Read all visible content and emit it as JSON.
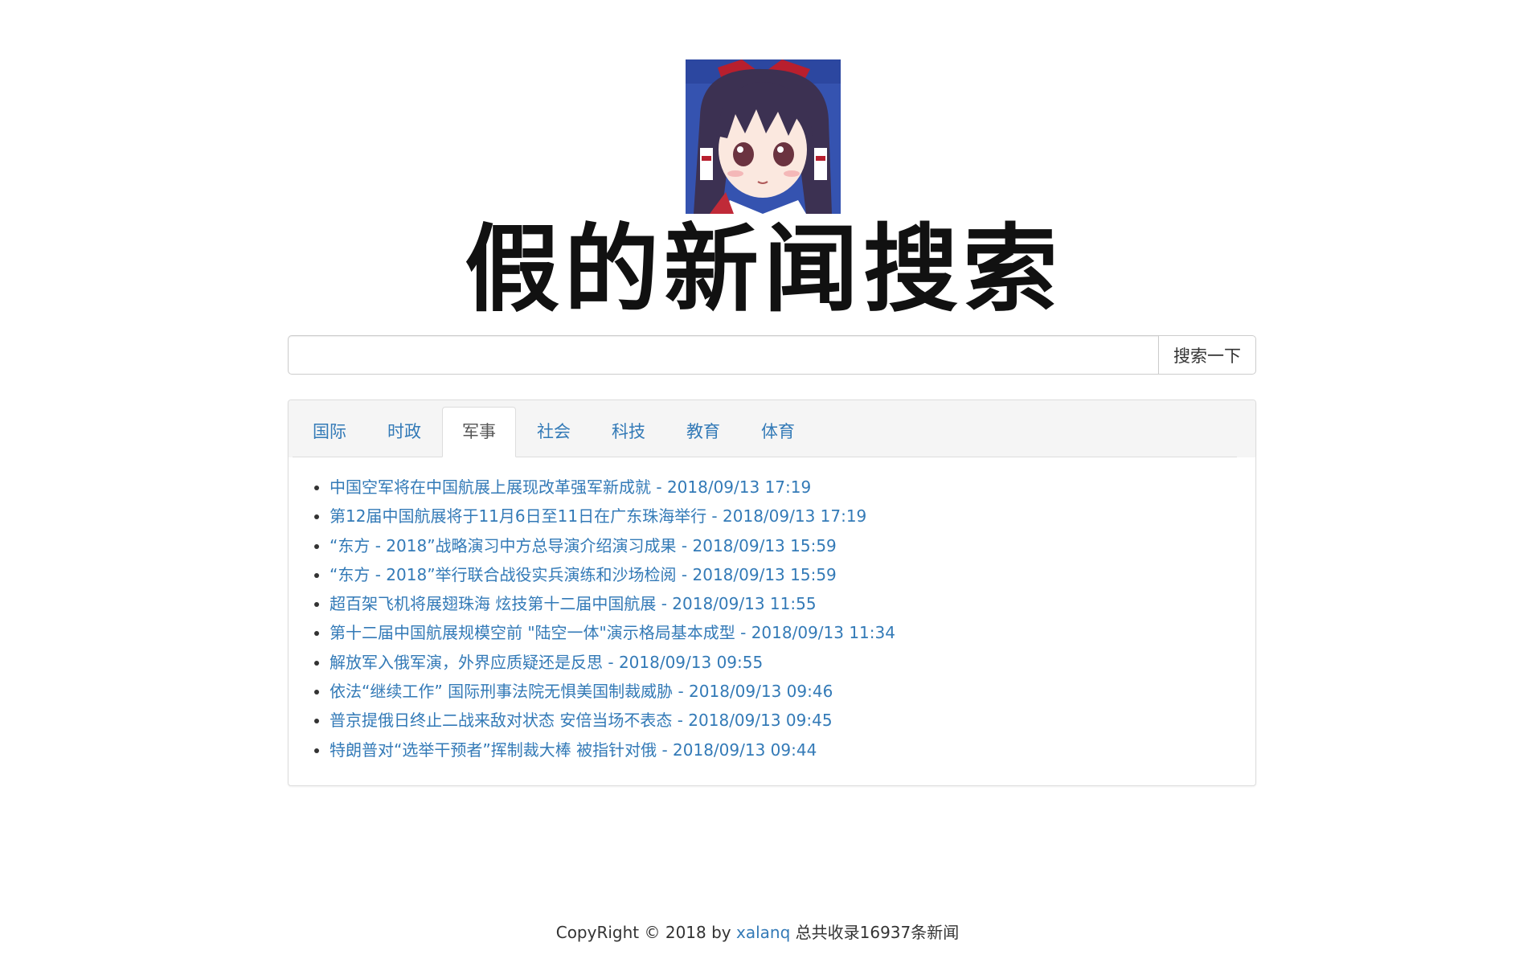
{
  "header": {
    "site_title": "假的新闻搜索"
  },
  "search": {
    "input_value": "",
    "placeholder": "",
    "button_label": "搜索一下"
  },
  "tabs": [
    {
      "label": "国际",
      "active": false
    },
    {
      "label": "时政",
      "active": false
    },
    {
      "label": "军事",
      "active": true
    },
    {
      "label": "社会",
      "active": false
    },
    {
      "label": "科技",
      "active": false
    },
    {
      "label": "教育",
      "active": false
    },
    {
      "label": "体育",
      "active": false
    }
  ],
  "news": [
    {
      "title": "中国空军将在中国航展上展现改革强军新成就",
      "time": "2018/09/13 17:19"
    },
    {
      "title": "第12届中国航展将于11月6日至11日在广东珠海举行",
      "time": "2018/09/13 17:19"
    },
    {
      "title": "“东方 - 2018”战略演习中方总导演介绍演习成果",
      "time": "2018/09/13 15:59"
    },
    {
      "title": "“东方 - 2018”举行联合战役实兵演练和沙场检阅",
      "time": "2018/09/13 15:59"
    },
    {
      "title": "超百架飞机将展翅珠海 炫技第十二届中国航展",
      "time": "2018/09/13 11:55"
    },
    {
      "title": "第十二届中国航展规模空前 \"陆空一体\"演示格局基本成型",
      "time": "2018/09/13 11:34"
    },
    {
      "title": "解放军入俄军演，外界应质疑还是反思",
      "time": "2018/09/13 09:55"
    },
    {
      "title": "依法“继续工作” 国际刑事法院无惧美国制裁威胁",
      "time": "2018/09/13 09:46"
    },
    {
      "title": "普京提俄日终止二战来敌对状态 安倍当场不表态",
      "time": "2018/09/13 09:45"
    },
    {
      "title": "特朗普对“选举干预者”挥制裁大棒 被指针对俄",
      "time": "2018/09/13 09:44"
    }
  ],
  "footer": {
    "prefix": "CopyRight © 2018 by ",
    "author": "xalanq",
    "suffix": " 总共收录16937条新闻"
  },
  "colors": {
    "link": "#337ab7",
    "text": "#333333",
    "border": "#dddddd",
    "panel_heading_bg": "#f5f5f5"
  }
}
